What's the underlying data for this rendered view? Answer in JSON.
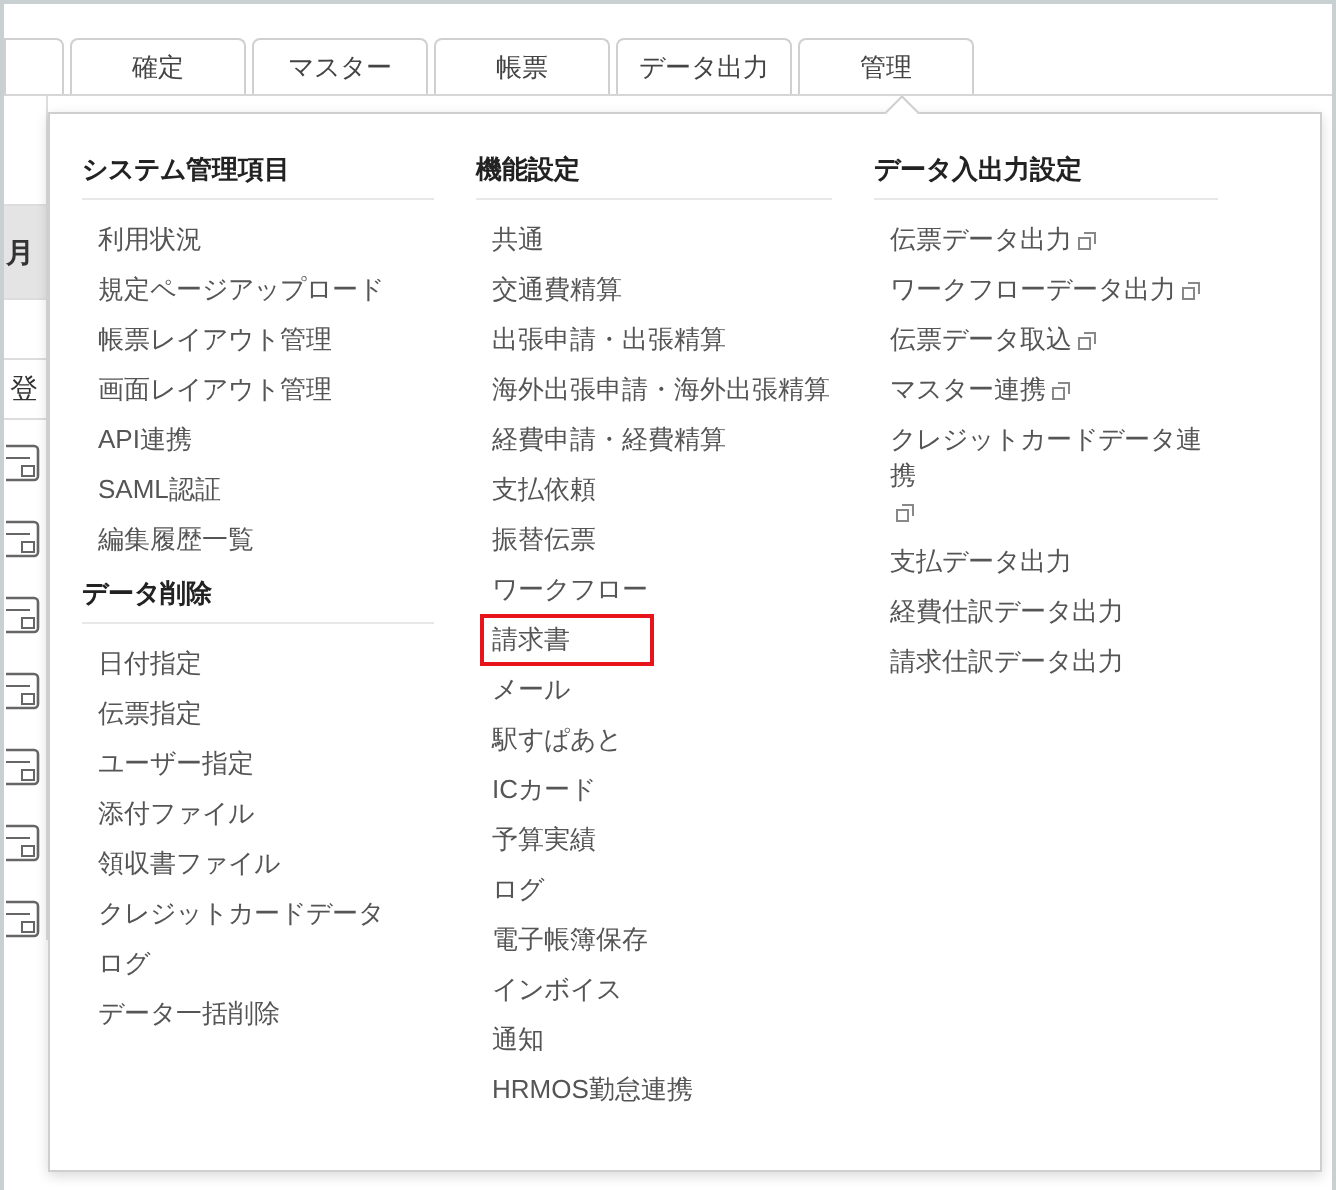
{
  "tabs": [
    {
      "label": "確定"
    },
    {
      "label": "マスター"
    },
    {
      "label": "帳票"
    },
    {
      "label": "データ出力"
    },
    {
      "label": "管理"
    }
  ],
  "background": {
    "row_labels": [
      "月",
      "登"
    ]
  },
  "menu": {
    "columns": [
      {
        "sections": [
          {
            "heading": "システム管理項目",
            "items": [
              {
                "label": "利用状況",
                "highlighted": false
              },
              {
                "label": "規定ページアップロード",
                "highlighted": false
              },
              {
                "label": "帳票レイアウト管理",
                "highlighted": false
              },
              {
                "label": "画面レイアウト管理",
                "highlighted": false
              },
              {
                "label": "API連携",
                "highlighted": false
              },
              {
                "label": "SAML認証",
                "highlighted": false
              },
              {
                "label": "編集履歴一覧",
                "highlighted": false
              }
            ]
          },
          {
            "heading": "データ削除",
            "items": [
              {
                "label": "日付指定",
                "highlighted": false
              },
              {
                "label": "伝票指定",
                "highlighted": false
              },
              {
                "label": "ユーザー指定",
                "highlighted": false
              },
              {
                "label": "添付ファイル",
                "highlighted": false
              },
              {
                "label": "領収書ファイル",
                "highlighted": false
              },
              {
                "label": "クレジットカードデータ",
                "highlighted": false
              },
              {
                "label": "ログ",
                "highlighted": false
              },
              {
                "label": "データ一括削除",
                "highlighted": false
              }
            ]
          }
        ]
      },
      {
        "sections": [
          {
            "heading": "機能設定",
            "items": [
              {
                "label": "共通",
                "highlighted": false
              },
              {
                "label": "交通費精算",
                "highlighted": false
              },
              {
                "label": "出張申請・出張精算",
                "highlighted": false
              },
              {
                "label": "海外出張申請・海外出張精算",
                "highlighted": false
              },
              {
                "label": "経費申請・経費精算",
                "highlighted": false
              },
              {
                "label": "支払依頼",
                "highlighted": false
              },
              {
                "label": "振替伝票",
                "highlighted": false
              },
              {
                "label": "ワークフロー",
                "highlighted": false
              },
              {
                "label": "請求書",
                "highlighted": true
              },
              {
                "label": "メール",
                "highlighted": false
              },
              {
                "label": "駅すぱあと",
                "highlighted": false
              },
              {
                "label": "ICカード",
                "highlighted": false
              },
              {
                "label": "予算実績",
                "highlighted": false
              },
              {
                "label": "ログ",
                "highlighted": false
              },
              {
                "label": "電子帳簿保存",
                "highlighted": false
              },
              {
                "label": "インボイス",
                "highlighted": false
              },
              {
                "label": "通知",
                "highlighted": false
              },
              {
                "label": "HRMOS勤怠連携",
                "highlighted": false
              }
            ]
          }
        ]
      },
      {
        "sections": [
          {
            "heading": "データ入出力設定",
            "items": [
              {
                "label": "伝票データ出力",
                "highlighted": false,
                "external": true
              },
              {
                "label": "ワークフローデータ出力",
                "highlighted": false,
                "external": true
              },
              {
                "label": "伝票データ取込",
                "highlighted": false,
                "external": true
              },
              {
                "label": "マスター連携",
                "highlighted": false,
                "external": true
              },
              {
                "label": "クレジットカードデータ連携",
                "highlighted": false,
                "external": true
              },
              {
                "label": "支払データ出力",
                "highlighted": false,
                "external": false
              },
              {
                "label": "経費仕訳データ出力",
                "highlighted": false,
                "external": false
              },
              {
                "label": "請求仕訳データ出力",
                "highlighted": false,
                "external": false
              }
            ]
          }
        ]
      }
    ]
  }
}
